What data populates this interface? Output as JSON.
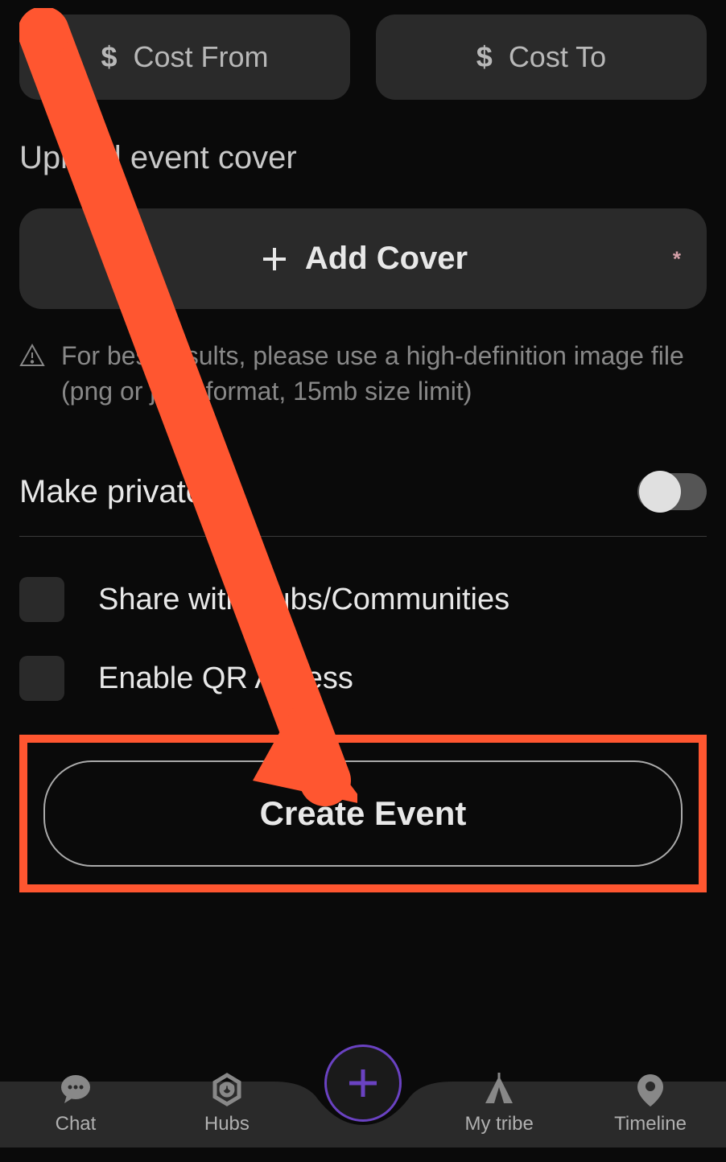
{
  "cost": {
    "from_prefix": "$",
    "from_placeholder": "Cost From",
    "to_prefix": "$",
    "to_placeholder": "Cost To"
  },
  "upload": {
    "section_title": "Upload event cover",
    "add_cover_label": "Add Cover",
    "required_mark": "*",
    "hint_text": "For best results, please use a high-definition image file (png or jpeg format, 15mb size limit)"
  },
  "private": {
    "label": "Make private",
    "enabled": false
  },
  "checkboxes": {
    "share_label": "Share with Hubs/Communities",
    "qr_label": "Enable QR Access"
  },
  "create_button": {
    "label": "Create Event"
  },
  "nav": {
    "chat": "Chat",
    "hubs": "Hubs",
    "mytribe": "My tribe",
    "timeline": "Timeline"
  },
  "annotation": {
    "highlight_color": "#ff5630"
  }
}
